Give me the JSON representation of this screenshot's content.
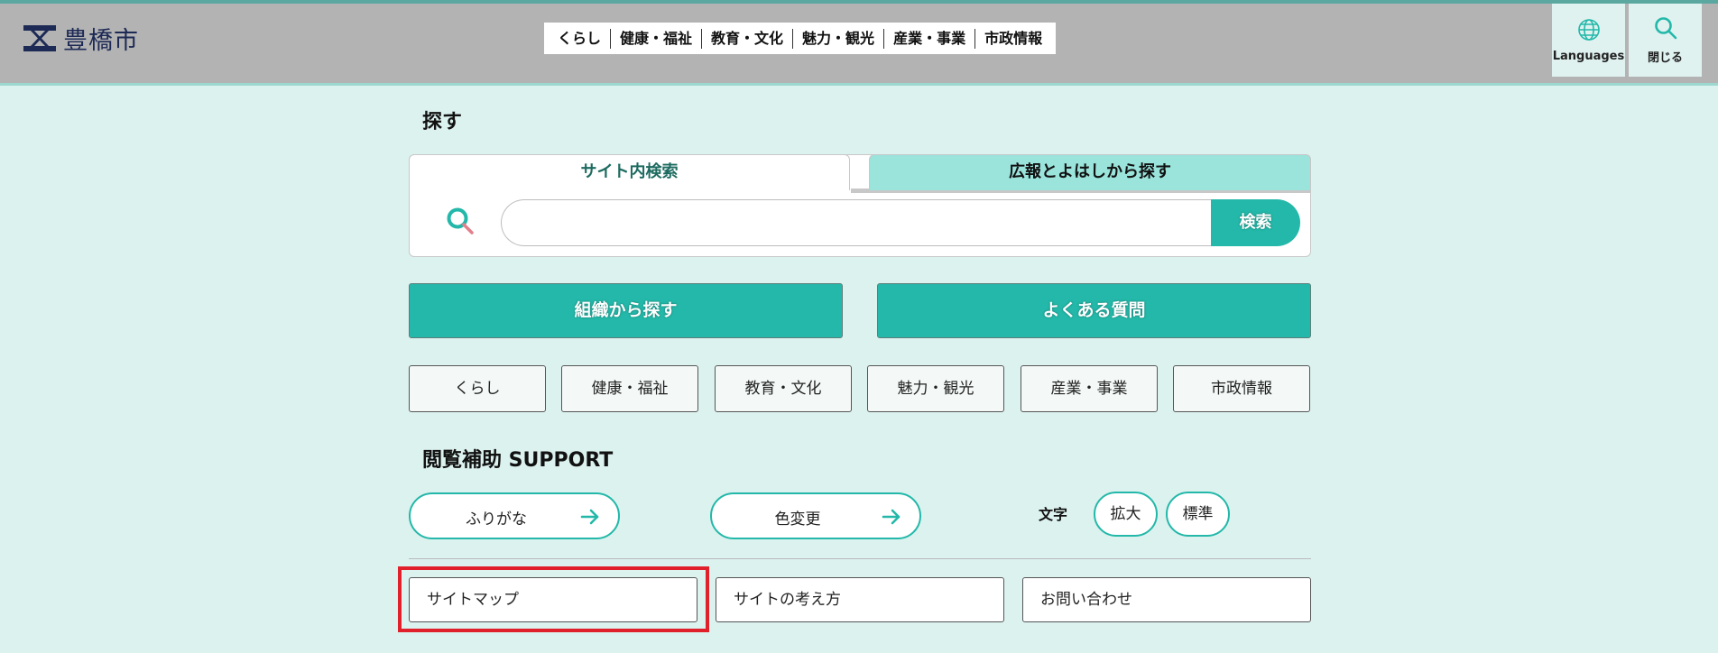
{
  "header": {
    "logo_text": "豊橋市",
    "nav": [
      "くらし",
      "健康・福祉",
      "教育・文化",
      "魅力・観光",
      "産業・事業",
      "市政情報"
    ],
    "languages_label": "Languages",
    "close_label": "閉じる"
  },
  "search": {
    "section_title": "探す",
    "tab_site": "サイト内検索",
    "tab_koho": "広報とよはしから探す",
    "input_value": "",
    "input_placeholder": "",
    "button_label": "検索"
  },
  "quick": {
    "org_label": "組織から探す",
    "faq_label": "よくある質問"
  },
  "categories": [
    "くらし",
    "健康・福祉",
    "教育・文化",
    "魅力・観光",
    "産業・事業",
    "市政情報"
  ],
  "support": {
    "section_title": "閲覧補助 SUPPORT",
    "furigana_label": "ふりがな",
    "color_label": "色変更",
    "moji_label": "文字",
    "enlarge_label": "拡大",
    "standard_label": "標準"
  },
  "links": [
    "サイトマップ",
    "サイトの考え方",
    "お問い合わせ"
  ],
  "colors": {
    "accent": "#23b8a9",
    "background": "#dcf2ef",
    "header": "#b3b3b3",
    "highlight": "#e0202a"
  }
}
